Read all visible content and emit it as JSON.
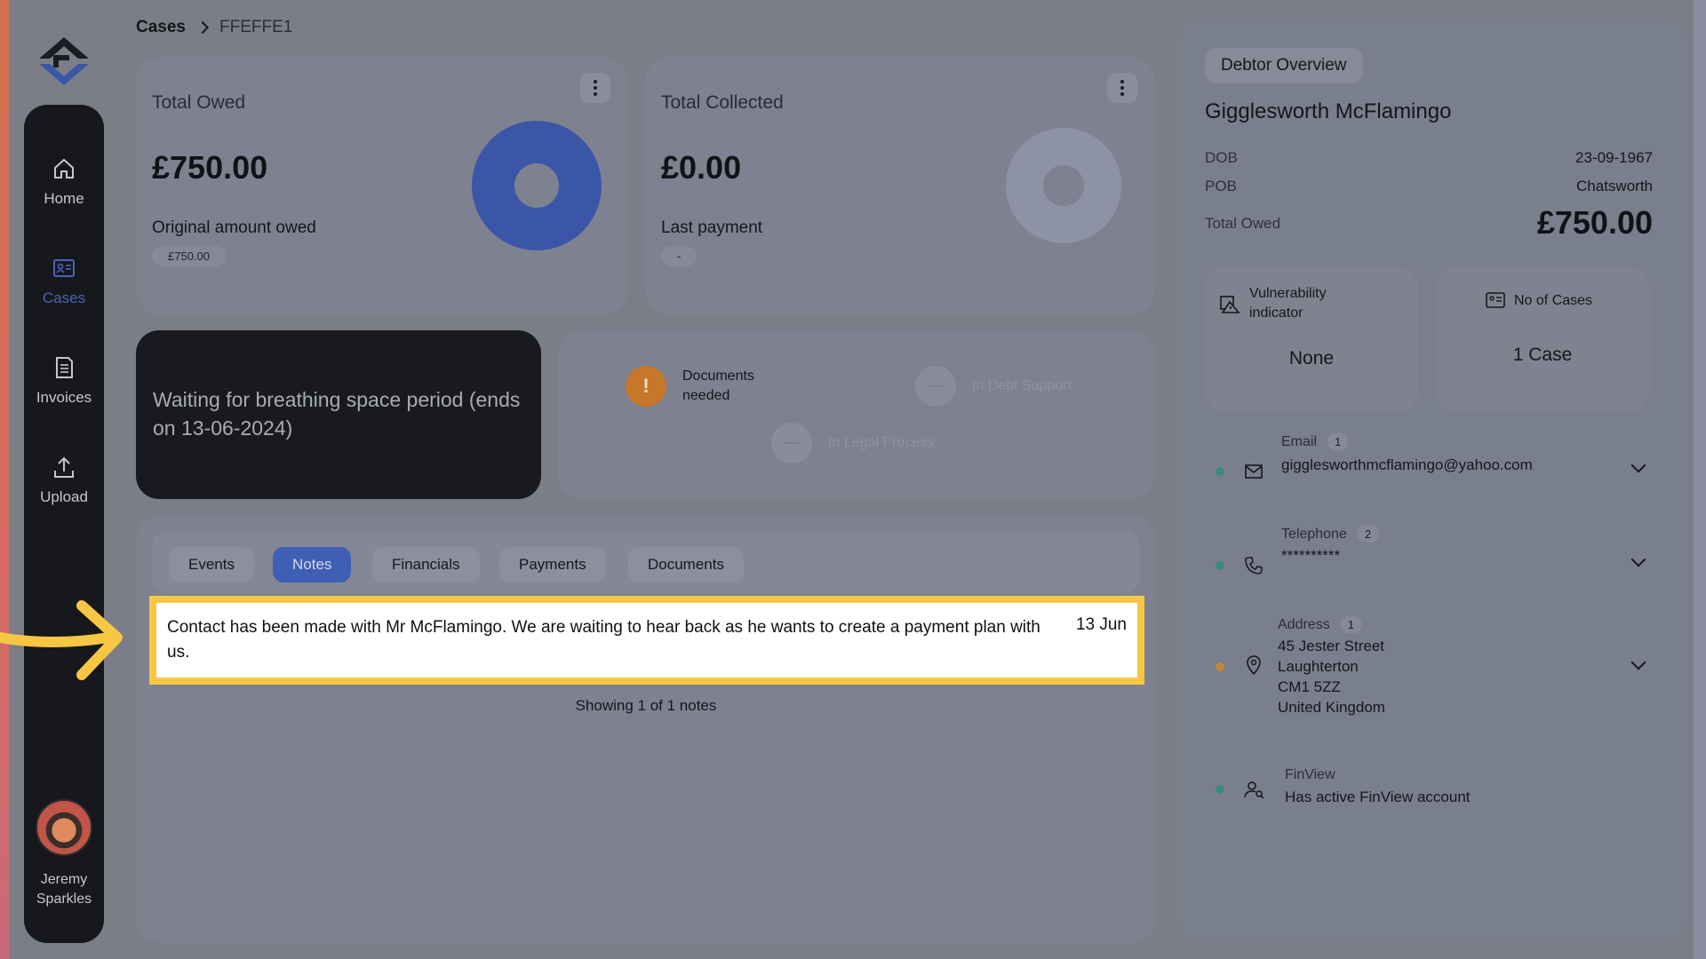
{
  "breadcrumb": {
    "root": "Cases",
    "current": "FFEFFE1"
  },
  "sidebar": {
    "items": [
      {
        "label": "Home",
        "icon": "home-icon"
      },
      {
        "label": "Cases",
        "icon": "cases-icon"
      },
      {
        "label": "Invoices",
        "icon": "invoice-icon"
      },
      {
        "label": "Upload",
        "icon": "upload-icon"
      }
    ],
    "active": "Cases",
    "user": {
      "first": "Jeremy",
      "last": "Sparkles"
    }
  },
  "total_owed": {
    "title": "Total Owed",
    "value": "£750.00",
    "sub_label": "Original amount owed",
    "sub_value": "£750.00"
  },
  "total_collected": {
    "title": "Total Collected",
    "value": "£0.00",
    "sub_label": "Last payment",
    "sub_value": "-"
  },
  "status": {
    "text": "Waiting for breathing space period (ends on 13-06-2024)"
  },
  "flags": {
    "documents": {
      "line1": "Documents",
      "line2": "needed",
      "icon": "!"
    },
    "debt_support": "In Debt Support",
    "legal_process": "In Legal Process"
  },
  "tabs": [
    "Events",
    "Notes",
    "Financials",
    "Payments",
    "Documents"
  ],
  "active_tab": "Notes",
  "note": {
    "text": "Contact has been made with Mr McFlamingo. We are waiting to hear back as he wants to create a payment plan with us.",
    "date": "13 Jun"
  },
  "notes_count": "Showing 1 of 1 notes",
  "debtor": {
    "chip": "Debtor Overview",
    "name": "Gigglesworth McFlamingo",
    "dob_label": "DOB",
    "dob": "23-09-1967",
    "pob_label": "POB",
    "pob": "Chatsworth",
    "total_owed_label": "Total Owed",
    "total_owed": "£750.00",
    "vulnerability": {
      "line1": "Vulnerability",
      "line2": "indicator",
      "value": "None"
    },
    "cases": {
      "label": "No of Cases",
      "value": "1 Case"
    },
    "email": {
      "label": "Email",
      "count": "1",
      "value": "gigglesworthmcflamingo@yahoo.com"
    },
    "telephone": {
      "label": "Telephone",
      "count": "2",
      "value": "**********"
    },
    "address": {
      "label": "Address",
      "count": "1",
      "line1": "45 Jester Street",
      "line2": "Laughterton",
      "line3": "CM1 5ZZ",
      "line4": "United Kingdom"
    },
    "finview": {
      "label": "FinView",
      "value": "Has active FinView account"
    }
  },
  "colors": {
    "accent_blue": "#3f5fb5",
    "highlight_yellow": "#f7c744",
    "warning_orange": "#c7772a",
    "status_green": "#3f8a7a",
    "status_amber": "#c0893a"
  }
}
